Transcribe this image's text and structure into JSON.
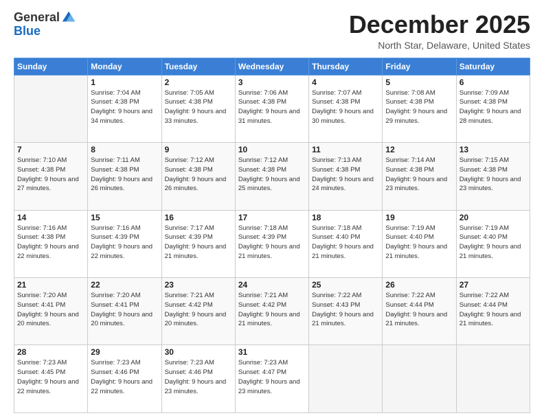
{
  "header": {
    "logo_general": "General",
    "logo_blue": "Blue",
    "month_title": "December 2025",
    "location": "North Star, Delaware, United States"
  },
  "days_of_week": [
    "Sunday",
    "Monday",
    "Tuesday",
    "Wednesday",
    "Thursday",
    "Friday",
    "Saturday"
  ],
  "weeks": [
    [
      {
        "day": "",
        "sunrise": "",
        "sunset": "",
        "daylight": "",
        "empty": true
      },
      {
        "day": "1",
        "sunrise": "Sunrise: 7:04 AM",
        "sunset": "Sunset: 4:38 PM",
        "daylight": "Daylight: 9 hours and 34 minutes.",
        "empty": false
      },
      {
        "day": "2",
        "sunrise": "Sunrise: 7:05 AM",
        "sunset": "Sunset: 4:38 PM",
        "daylight": "Daylight: 9 hours and 33 minutes.",
        "empty": false
      },
      {
        "day": "3",
        "sunrise": "Sunrise: 7:06 AM",
        "sunset": "Sunset: 4:38 PM",
        "daylight": "Daylight: 9 hours and 31 minutes.",
        "empty": false
      },
      {
        "day": "4",
        "sunrise": "Sunrise: 7:07 AM",
        "sunset": "Sunset: 4:38 PM",
        "daylight": "Daylight: 9 hours and 30 minutes.",
        "empty": false
      },
      {
        "day": "5",
        "sunrise": "Sunrise: 7:08 AM",
        "sunset": "Sunset: 4:38 PM",
        "daylight": "Daylight: 9 hours and 29 minutes.",
        "empty": false
      },
      {
        "day": "6",
        "sunrise": "Sunrise: 7:09 AM",
        "sunset": "Sunset: 4:38 PM",
        "daylight": "Daylight: 9 hours and 28 minutes.",
        "empty": false
      }
    ],
    [
      {
        "day": "7",
        "sunrise": "Sunrise: 7:10 AM",
        "sunset": "Sunset: 4:38 PM",
        "daylight": "Daylight: 9 hours and 27 minutes.",
        "empty": false
      },
      {
        "day": "8",
        "sunrise": "Sunrise: 7:11 AM",
        "sunset": "Sunset: 4:38 PM",
        "daylight": "Daylight: 9 hours and 26 minutes.",
        "empty": false
      },
      {
        "day": "9",
        "sunrise": "Sunrise: 7:12 AM",
        "sunset": "Sunset: 4:38 PM",
        "daylight": "Daylight: 9 hours and 26 minutes.",
        "empty": false
      },
      {
        "day": "10",
        "sunrise": "Sunrise: 7:12 AM",
        "sunset": "Sunset: 4:38 PM",
        "daylight": "Daylight: 9 hours and 25 minutes.",
        "empty": false
      },
      {
        "day": "11",
        "sunrise": "Sunrise: 7:13 AM",
        "sunset": "Sunset: 4:38 PM",
        "daylight": "Daylight: 9 hours and 24 minutes.",
        "empty": false
      },
      {
        "day": "12",
        "sunrise": "Sunrise: 7:14 AM",
        "sunset": "Sunset: 4:38 PM",
        "daylight": "Daylight: 9 hours and 23 minutes.",
        "empty": false
      },
      {
        "day": "13",
        "sunrise": "Sunrise: 7:15 AM",
        "sunset": "Sunset: 4:38 PM",
        "daylight": "Daylight: 9 hours and 23 minutes.",
        "empty": false
      }
    ],
    [
      {
        "day": "14",
        "sunrise": "Sunrise: 7:16 AM",
        "sunset": "Sunset: 4:38 PM",
        "daylight": "Daylight: 9 hours and 22 minutes.",
        "empty": false
      },
      {
        "day": "15",
        "sunrise": "Sunrise: 7:16 AM",
        "sunset": "Sunset: 4:39 PM",
        "daylight": "Daylight: 9 hours and 22 minutes.",
        "empty": false
      },
      {
        "day": "16",
        "sunrise": "Sunrise: 7:17 AM",
        "sunset": "Sunset: 4:39 PM",
        "daylight": "Daylight: 9 hours and 21 minutes.",
        "empty": false
      },
      {
        "day": "17",
        "sunrise": "Sunrise: 7:18 AM",
        "sunset": "Sunset: 4:39 PM",
        "daylight": "Daylight: 9 hours and 21 minutes.",
        "empty": false
      },
      {
        "day": "18",
        "sunrise": "Sunrise: 7:18 AM",
        "sunset": "Sunset: 4:40 PM",
        "daylight": "Daylight: 9 hours and 21 minutes.",
        "empty": false
      },
      {
        "day": "19",
        "sunrise": "Sunrise: 7:19 AM",
        "sunset": "Sunset: 4:40 PM",
        "daylight": "Daylight: 9 hours and 21 minutes.",
        "empty": false
      },
      {
        "day": "20",
        "sunrise": "Sunrise: 7:19 AM",
        "sunset": "Sunset: 4:40 PM",
        "daylight": "Daylight: 9 hours and 21 minutes.",
        "empty": false
      }
    ],
    [
      {
        "day": "21",
        "sunrise": "Sunrise: 7:20 AM",
        "sunset": "Sunset: 4:41 PM",
        "daylight": "Daylight: 9 hours and 20 minutes.",
        "empty": false
      },
      {
        "day": "22",
        "sunrise": "Sunrise: 7:20 AM",
        "sunset": "Sunset: 4:41 PM",
        "daylight": "Daylight: 9 hours and 20 minutes.",
        "empty": false
      },
      {
        "day": "23",
        "sunrise": "Sunrise: 7:21 AM",
        "sunset": "Sunset: 4:42 PM",
        "daylight": "Daylight: 9 hours and 20 minutes.",
        "empty": false
      },
      {
        "day": "24",
        "sunrise": "Sunrise: 7:21 AM",
        "sunset": "Sunset: 4:42 PM",
        "daylight": "Daylight: 9 hours and 21 minutes.",
        "empty": false
      },
      {
        "day": "25",
        "sunrise": "Sunrise: 7:22 AM",
        "sunset": "Sunset: 4:43 PM",
        "daylight": "Daylight: 9 hours and 21 minutes.",
        "empty": false
      },
      {
        "day": "26",
        "sunrise": "Sunrise: 7:22 AM",
        "sunset": "Sunset: 4:44 PM",
        "daylight": "Daylight: 9 hours and 21 minutes.",
        "empty": false
      },
      {
        "day": "27",
        "sunrise": "Sunrise: 7:22 AM",
        "sunset": "Sunset: 4:44 PM",
        "daylight": "Daylight: 9 hours and 21 minutes.",
        "empty": false
      }
    ],
    [
      {
        "day": "28",
        "sunrise": "Sunrise: 7:23 AM",
        "sunset": "Sunset: 4:45 PM",
        "daylight": "Daylight: 9 hours and 22 minutes.",
        "empty": false
      },
      {
        "day": "29",
        "sunrise": "Sunrise: 7:23 AM",
        "sunset": "Sunset: 4:46 PM",
        "daylight": "Daylight: 9 hours and 22 minutes.",
        "empty": false
      },
      {
        "day": "30",
        "sunrise": "Sunrise: 7:23 AM",
        "sunset": "Sunset: 4:46 PM",
        "daylight": "Daylight: 9 hours and 23 minutes.",
        "empty": false
      },
      {
        "day": "31",
        "sunrise": "Sunrise: 7:23 AM",
        "sunset": "Sunset: 4:47 PM",
        "daylight": "Daylight: 9 hours and 23 minutes.",
        "empty": false
      },
      {
        "day": "",
        "sunrise": "",
        "sunset": "",
        "daylight": "",
        "empty": true
      },
      {
        "day": "",
        "sunrise": "",
        "sunset": "",
        "daylight": "",
        "empty": true
      },
      {
        "day": "",
        "sunrise": "",
        "sunset": "",
        "daylight": "",
        "empty": true
      }
    ]
  ]
}
